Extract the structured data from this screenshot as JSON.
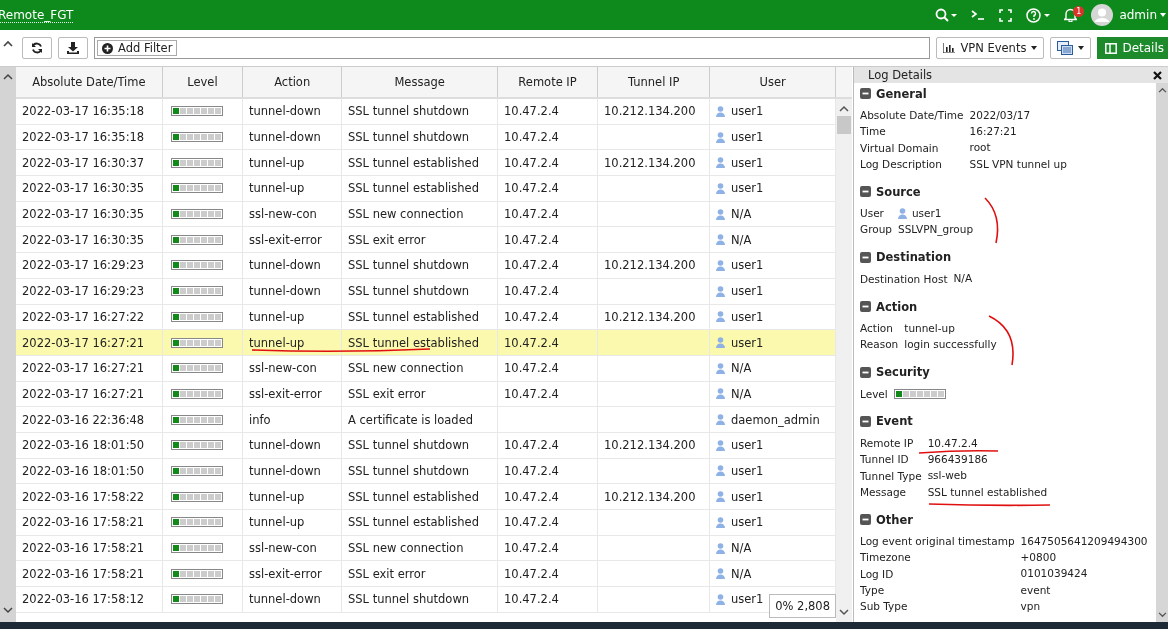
{
  "top_bar": {
    "device_name": "Remote_FGT",
    "notification_count": "1",
    "user": "admin"
  },
  "toolbar": {
    "filter_button": "Add Filter",
    "view_dropdown": "VPN Events",
    "details_button": "Details"
  },
  "table": {
    "columns": [
      "Absolute Date/Time",
      "Level",
      "Action",
      "Message",
      "Remote IP",
      "Tunnel IP",
      "User"
    ],
    "rows": [
      {
        "time": "2022-03-17 16:35:18",
        "level": 0.14,
        "action": "tunnel-down",
        "message": "SSL tunnel shutdown",
        "remote_ip": "10.47.2.4",
        "tunnel_ip": "10.212.134.200",
        "user": "user1",
        "selected": false
      },
      {
        "time": "2022-03-17 16:35:18",
        "level": 0.14,
        "action": "tunnel-down",
        "message": "SSL tunnel shutdown",
        "remote_ip": "10.47.2.4",
        "tunnel_ip": "",
        "user": "user1",
        "selected": false
      },
      {
        "time": "2022-03-17 16:30:37",
        "level": 0.14,
        "action": "tunnel-up",
        "message": "SSL tunnel established",
        "remote_ip": "10.47.2.4",
        "tunnel_ip": "10.212.134.200",
        "user": "user1",
        "selected": false
      },
      {
        "time": "2022-03-17 16:30:35",
        "level": 0.14,
        "action": "tunnel-up",
        "message": "SSL tunnel established",
        "remote_ip": "10.47.2.4",
        "tunnel_ip": "",
        "user": "user1",
        "selected": false
      },
      {
        "time": "2022-03-17 16:30:35",
        "level": 0.14,
        "action": "ssl-new-con",
        "message": "SSL new connection",
        "remote_ip": "10.47.2.4",
        "tunnel_ip": "",
        "user": "N/A",
        "selected": false
      },
      {
        "time": "2022-03-17 16:30:35",
        "level": 0.14,
        "action": "ssl-exit-error",
        "message": "SSL exit error",
        "remote_ip": "10.47.2.4",
        "tunnel_ip": "",
        "user": "N/A",
        "selected": false
      },
      {
        "time": "2022-03-17 16:29:23",
        "level": 0.14,
        "action": "tunnel-down",
        "message": "SSL tunnel shutdown",
        "remote_ip": "10.47.2.4",
        "tunnel_ip": "10.212.134.200",
        "user": "user1",
        "selected": false
      },
      {
        "time": "2022-03-17 16:29:23",
        "level": 0.14,
        "action": "tunnel-down",
        "message": "SSL tunnel shutdown",
        "remote_ip": "10.47.2.4",
        "tunnel_ip": "",
        "user": "user1",
        "selected": false
      },
      {
        "time": "2022-03-17 16:27:22",
        "level": 0.14,
        "action": "tunnel-up",
        "message": "SSL tunnel established",
        "remote_ip": "10.47.2.4",
        "tunnel_ip": "10.212.134.200",
        "user": "user1",
        "selected": false
      },
      {
        "time": "2022-03-17 16:27:21",
        "level": 0.14,
        "action": "tunnel-up",
        "message": "SSL tunnel established",
        "remote_ip": "10.47.2.4",
        "tunnel_ip": "",
        "user": "user1",
        "selected": true
      },
      {
        "time": "2022-03-17 16:27:21",
        "level": 0.14,
        "action": "ssl-new-con",
        "message": "SSL new connection",
        "remote_ip": "10.47.2.4",
        "tunnel_ip": "",
        "user": "N/A",
        "selected": false
      },
      {
        "time": "2022-03-17 16:27:21",
        "level": 0.14,
        "action": "ssl-exit-error",
        "message": "SSL exit error",
        "remote_ip": "10.47.2.4",
        "tunnel_ip": "",
        "user": "N/A",
        "selected": false
      },
      {
        "time": "2022-03-16 22:36:48",
        "level": 0.14,
        "action": "info",
        "message": "A certificate is loaded",
        "remote_ip": "",
        "tunnel_ip": "",
        "user": "daemon_admin",
        "selected": false
      },
      {
        "time": "2022-03-16 18:01:50",
        "level": 0.14,
        "action": "tunnel-down",
        "message": "SSL tunnel shutdown",
        "remote_ip": "10.47.2.4",
        "tunnel_ip": "10.212.134.200",
        "user": "user1",
        "selected": false
      },
      {
        "time": "2022-03-16 18:01:50",
        "level": 0.14,
        "action": "tunnel-down",
        "message": "SSL tunnel shutdown",
        "remote_ip": "10.47.2.4",
        "tunnel_ip": "",
        "user": "user1",
        "selected": false
      },
      {
        "time": "2022-03-16 17:58:22",
        "level": 0.14,
        "action": "tunnel-up",
        "message": "SSL tunnel established",
        "remote_ip": "10.47.2.4",
        "tunnel_ip": "10.212.134.200",
        "user": "user1",
        "selected": false
      },
      {
        "time": "2022-03-16 17:58:21",
        "level": 0.14,
        "action": "tunnel-up",
        "message": "SSL tunnel established",
        "remote_ip": "10.47.2.4",
        "tunnel_ip": "",
        "user": "user1",
        "selected": false
      },
      {
        "time": "2022-03-16 17:58:21",
        "level": 0.14,
        "action": "ssl-new-con",
        "message": "SSL new connection",
        "remote_ip": "10.47.2.4",
        "tunnel_ip": "",
        "user": "N/A",
        "selected": false
      },
      {
        "time": "2022-03-16 17:58:21",
        "level": 0.14,
        "action": "ssl-exit-error",
        "message": "SSL exit error",
        "remote_ip": "10.47.2.4",
        "tunnel_ip": "",
        "user": "N/A",
        "selected": false
      },
      {
        "time": "2022-03-16 17:58:12",
        "level": 0.14,
        "action": "tunnel-down",
        "message": "SSL tunnel shutdown",
        "remote_ip": "10.47.2.4",
        "tunnel_ip": "",
        "user": "user1",
        "selected": false
      }
    ],
    "progress_badge": "0% 2,808"
  },
  "details": {
    "title": "Log Details",
    "sections": [
      {
        "title": "General",
        "fields": [
          {
            "label": "Absolute Date/Time",
            "value": "2022/03/17"
          },
          {
            "label": "Time",
            "value": "16:27:21"
          },
          {
            "label": "Virtual Domain",
            "value": "root"
          },
          {
            "label": "Log Description",
            "value": "SSL VPN tunnel up"
          }
        ]
      },
      {
        "title": "Source",
        "fields": [
          {
            "label": "User",
            "value": "user1",
            "kind": "user"
          },
          {
            "label": "Group",
            "value": "SSLVPN_group"
          }
        ]
      },
      {
        "title": "Destination",
        "fields": [
          {
            "label": "Destination Host",
            "value": "N/A"
          }
        ]
      },
      {
        "title": "Action",
        "fields": [
          {
            "label": "Action",
            "value": "tunnel-up"
          },
          {
            "label": "Reason",
            "value": "login successfully"
          }
        ]
      },
      {
        "title": "Security",
        "fields": [
          {
            "label": "Level",
            "kind": "meter",
            "level": 0.14
          }
        ]
      },
      {
        "title": "Event",
        "fields": [
          {
            "label": "Remote IP",
            "value": "10.47.2.4"
          },
          {
            "label": "Tunnel ID",
            "value": "966439186"
          },
          {
            "label": "Tunnel Type",
            "value": "ssl-web"
          },
          {
            "label": "Message",
            "value": "SSL tunnel established"
          }
        ]
      },
      {
        "title": "Other",
        "fields": [
          {
            "label": "Log event original timestamp",
            "value": "1647505641209494300"
          },
          {
            "label": "Timezone",
            "value": "+0800"
          },
          {
            "label": "Log ID",
            "value": "0101039424"
          },
          {
            "label": "Type",
            "value": "event"
          },
          {
            "label": "Sub Type",
            "value": "vpn"
          }
        ]
      }
    ]
  }
}
